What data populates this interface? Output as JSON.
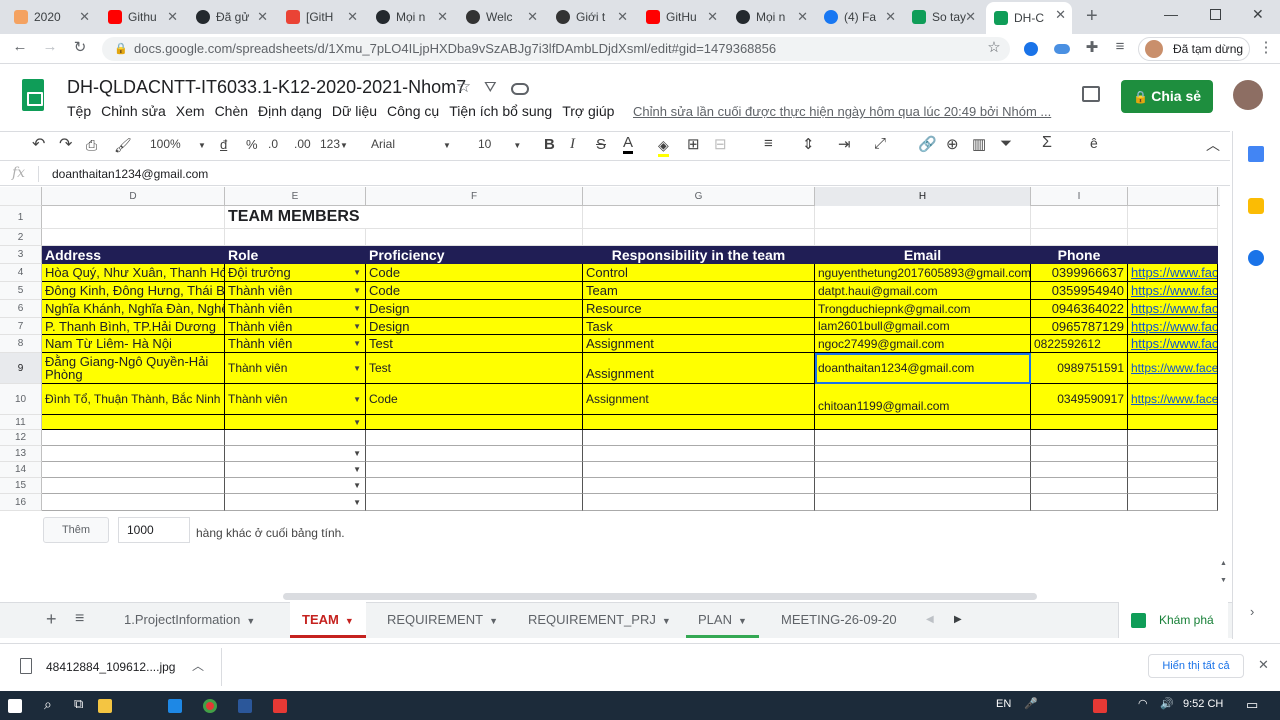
{
  "browser": {
    "tabs": [
      {
        "title": "2020"
      },
      {
        "title": "Githu"
      },
      {
        "title": "Đã gử"
      },
      {
        "title": "[GitH"
      },
      {
        "title": "Mọi n"
      },
      {
        "title": "Welc"
      },
      {
        "title": "Giới t"
      },
      {
        "title": "GitHu"
      },
      {
        "title": "Mọi n"
      },
      {
        "title": "(4) Fa"
      },
      {
        "title": "So tay"
      },
      {
        "title": "DH-C"
      }
    ],
    "new_tab": "+",
    "url": "docs.google.com/spreadsheets/d/1Xmu_7pLO4ILjpHXDba9vSzABJg7i3lfDAmbLDjdXsml/edit#gid=1479368856",
    "profile_label": "Đã tạm dừng"
  },
  "doc": {
    "title": "DH-QLDACNTT-IT6033.1-K12-2020-2021-Nhom7",
    "menus": [
      "Tệp",
      "Chỉnh sửa",
      "Xem",
      "Chèn",
      "Định dạng",
      "Dữ liệu",
      "Công cụ",
      "Tiện ích bổ sung",
      "Trợ giúp"
    ],
    "last_edit": "Chỉnh sửa lần cuối được thực hiện ngày hôm qua lúc 20:49 bởi Nhóm ...",
    "share_label": "Chia sẻ"
  },
  "toolbar": {
    "zoom": "100%",
    "currency": "đ",
    "percent": "%",
    "dec_less": ".0",
    "dec_more": ".00",
    "format_more": "123",
    "font": "Arial",
    "font_size": "10",
    "bold": "B",
    "italic": "I",
    "strike": "S",
    "text_color": "A"
  },
  "formula_bar": {
    "label": "fx",
    "value": "doanthaitan1234@gmail.com"
  },
  "columns": [
    "D",
    "E",
    "F",
    "G",
    "H",
    "I"
  ],
  "rows_numbers": [
    "1",
    "2",
    "3",
    "4",
    "5",
    "6",
    "7",
    "8",
    "9",
    "10",
    "11",
    "12",
    "13",
    "14",
    "15",
    "16"
  ],
  "sheet": {
    "title": "TEAM MEMBERS",
    "headers": [
      "Address",
      "Role",
      "Proficiency",
      "Responsibility in the team",
      "Email",
      "Phone"
    ],
    "rows": [
      {
        "address": "Hòa Quý, Như Xuân, Thanh Hóa",
        "role": "Đội trưởng",
        "proficiency": "Code",
        "responsibility": "Control",
        "email": "nguyenthetung2017605893@gmail.com",
        "phone": "0399966637",
        "link": "https://www.facebook.com"
      },
      {
        "address": "Đông Kinh, Đông Hưng, Thái Bình",
        "role": "Thành viên",
        "proficiency": "Code",
        "responsibility": "Team",
        "email": "datpt.haui@gmail.com",
        "phone": "0359954940",
        "link": "https://www.facebook.com"
      },
      {
        "address": "Nghĩa Khánh, Nghĩa Đàn, Nghệ An",
        "role": "Thành viên",
        "proficiency": "Design",
        "responsibility": "Resource",
        "email": "Trongduchiepnk@gmail.com",
        "phone": "0946364022",
        "link": "https://www.facebook.com"
      },
      {
        "address": "P. Thanh Bình, TP.Hải Dương",
        "role": "Thành viên",
        "proficiency": "Design",
        "responsibility": "Task",
        "email": "lam2601bull@gmail.com",
        "phone": "0965787129",
        "link": "https://www.facebook.com"
      },
      {
        "address": "Nam Từ Liêm- Hà Nội",
        "role": "Thành viên",
        "proficiency": "Test",
        "responsibility": "Assignment",
        "email": "ngoc27499@gmail.com",
        "phone": "0822592612",
        "link": "https://www.facebook.com"
      },
      {
        "address": "Đằng Giang-Ngô Quyền-Hải Phòng",
        "role": "Thành viên",
        "proficiency": "Test",
        "responsibility": "Assignment",
        "email": "doanthaitan1234@gmail.com",
        "phone": "0989751591",
        "link": "https://www.facebook.com"
      },
      {
        "address": "Đình Tổ, Thuận Thành, Bắc Ninh",
        "role": "Thành viên",
        "proficiency": "Code",
        "responsibility": "Assignment",
        "email": "chitoan1199@gmail.com",
        "phone": "0349590917",
        "link": "https://www.facebook.com"
      }
    ]
  },
  "add_rows": {
    "button": "Thêm",
    "count": "1000",
    "text": "hàng khác ở cuối bảng tính."
  },
  "sheet_tabs": [
    {
      "label": "1.ProjectInformation"
    },
    {
      "label": "TEAM"
    },
    {
      "label": "REQUIREMENT"
    },
    {
      "label": "REQUIREMENT_PRJ"
    },
    {
      "label": "PLAN"
    },
    {
      "label": "MEETING-26-09-20"
    }
  ],
  "explore_label": "Khám phá",
  "download": {
    "filename": "48412884_109612....jpg",
    "show_all": "Hiển thị tất cả"
  },
  "taskbar": {
    "lang": "EN",
    "time": "9:52 CH"
  },
  "colors": {
    "header_fill": "#201e55",
    "row_fill": "#ffff00",
    "share_green": "#1e8e3e",
    "active_tab_red": "#c5221f"
  }
}
